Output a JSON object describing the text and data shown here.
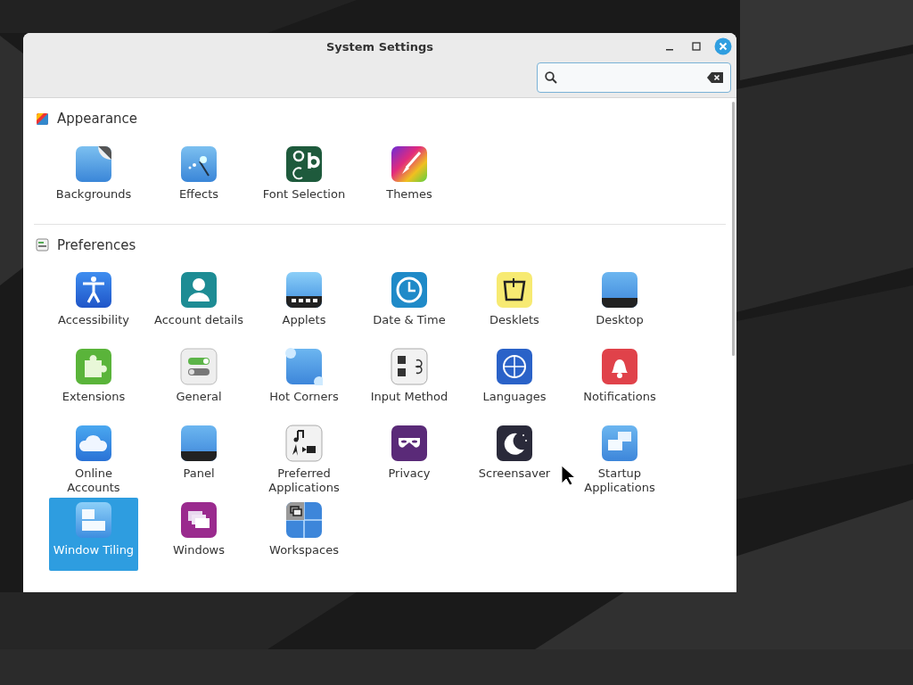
{
  "window": {
    "title": "System Settings"
  },
  "sections": [
    {
      "title": "Appearance",
      "items": [
        {
          "label": "Backgrounds",
          "selected": false
        },
        {
          "label": "Effects",
          "selected": false
        },
        {
          "label": "Font Selection",
          "selected": false
        },
        {
          "label": "Themes",
          "selected": false
        }
      ]
    },
    {
      "title": "Preferences",
      "items": [
        {
          "label": "Accessibility",
          "selected": false
        },
        {
          "label": "Account details",
          "selected": false
        },
        {
          "label": "Applets",
          "selected": false
        },
        {
          "label": "Date & Time",
          "selected": false
        },
        {
          "label": "Desklets",
          "selected": false
        },
        {
          "label": "Desktop",
          "selected": false
        },
        {
          "label": "Extensions",
          "selected": false
        },
        {
          "label": "General",
          "selected": false
        },
        {
          "label": "Hot Corners",
          "selected": false
        },
        {
          "label": "Input Method",
          "selected": false
        },
        {
          "label": "Languages",
          "selected": false
        },
        {
          "label": "Notifications",
          "selected": false
        },
        {
          "label": "Online\nAccounts",
          "selected": false
        },
        {
          "label": "Panel",
          "selected": false
        },
        {
          "label": "Preferred\nApplications",
          "selected": false
        },
        {
          "label": "Privacy",
          "selected": false
        },
        {
          "label": "Screensaver",
          "selected": false
        },
        {
          "label": "Startup\nApplications",
          "selected": false
        },
        {
          "label": "Window Tiling",
          "selected": true
        },
        {
          "label": "Windows",
          "selected": false
        },
        {
          "label": "Workspaces",
          "selected": false
        }
      ]
    }
  ]
}
